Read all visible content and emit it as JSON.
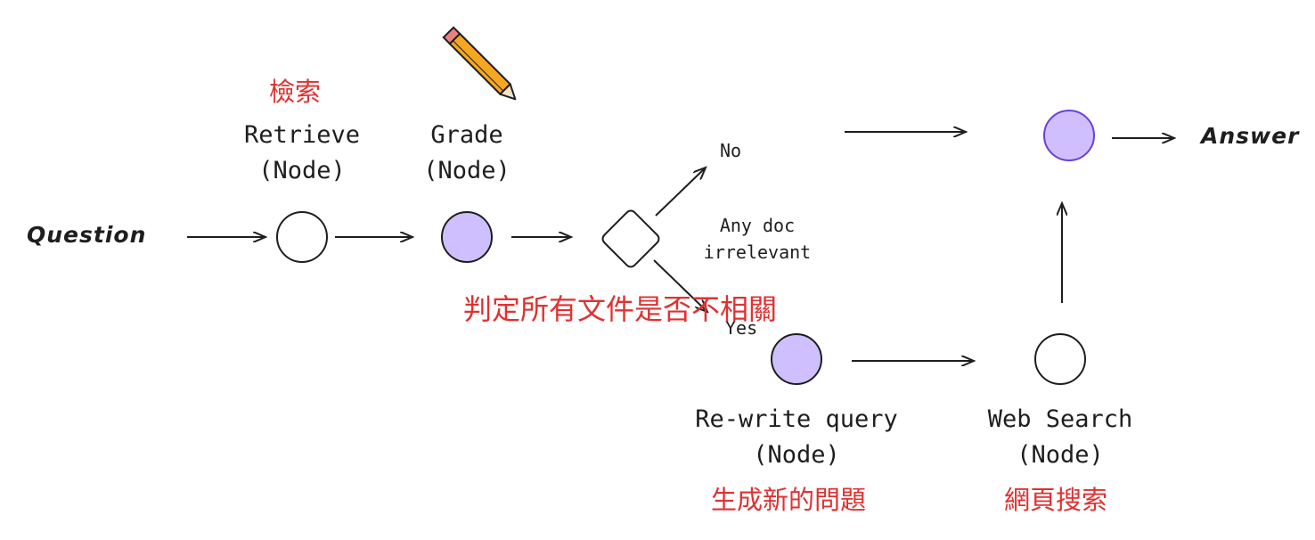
{
  "labels": {
    "question": "Question",
    "answer": "Answer",
    "retrieve_title": "Retrieve",
    "retrieve_type": "(Node)",
    "grade_title": "Grade",
    "grade_type": "(Node)",
    "rewrite_title": "Re-write query",
    "rewrite_type": "(Node)",
    "websearch_title": "Web Search",
    "websearch_type": "(Node)",
    "decision_line1": "Any doc",
    "decision_line2": "irrelevant",
    "branch_no": "No",
    "branch_yes": "Yes"
  },
  "annotations": {
    "retrieve": "檢索",
    "decision": "判定所有文件是否不相關",
    "rewrite": "生成新的問題",
    "websearch": "網頁搜索"
  },
  "colors": {
    "stroke": "#1e1e1e",
    "node_fill_purple": "#d0bfff",
    "node_stroke_purple": "#6741d9",
    "annotation_red": "#e03131",
    "pencil_body": "#f5a623",
    "pencil_tip": "#e8807f"
  },
  "icons": {
    "grade_icon": "pencil-icon"
  }
}
